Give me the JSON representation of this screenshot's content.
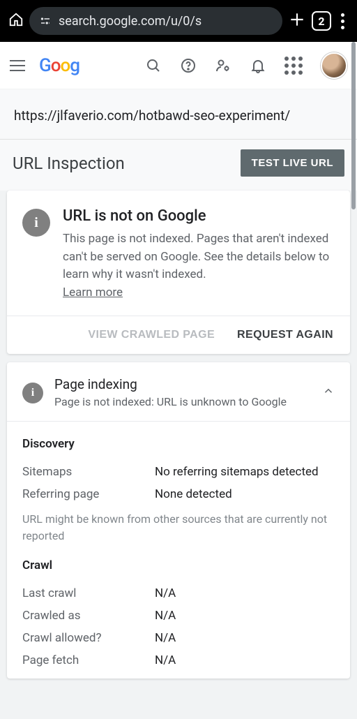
{
  "browser": {
    "url_display": "search.google.com/u/0/s",
    "tab_count": "2"
  },
  "header": {
    "logo_text": "Goog"
  },
  "inspection": {
    "url": "https://jlfaverio.com/hotbawd-seo-experiment/",
    "section_title": "URL Inspection",
    "test_live_label": "TEST LIVE URL"
  },
  "status": {
    "title": "URL is not on Google",
    "description": "This page is not indexed. Pages that aren't indexed can't be served on Google. See the details below to learn why it wasn't indexed.",
    "learn_more": "Learn more",
    "view_crawled": "VIEW CRAWLED PAGE",
    "request_again": "REQUEST AGAIN"
  },
  "indexing": {
    "title": "Page indexing",
    "subtitle": "Page is not indexed: URL is unknown to Google",
    "discovery": {
      "label": "Discovery",
      "rows": [
        {
          "key": "Sitemaps",
          "val": "No referring sitemaps detected"
        },
        {
          "key": "Referring page",
          "val": "None detected"
        }
      ],
      "note": "URL might be known from other sources that are currently not reported"
    },
    "crawl": {
      "label": "Crawl",
      "rows": [
        {
          "key": "Last crawl",
          "val": "N/A"
        },
        {
          "key": "Crawled as",
          "val": "N/A"
        },
        {
          "key": "Crawl allowed?",
          "val": "N/A"
        },
        {
          "key": "Page fetch",
          "val": "N/A"
        }
      ]
    }
  }
}
